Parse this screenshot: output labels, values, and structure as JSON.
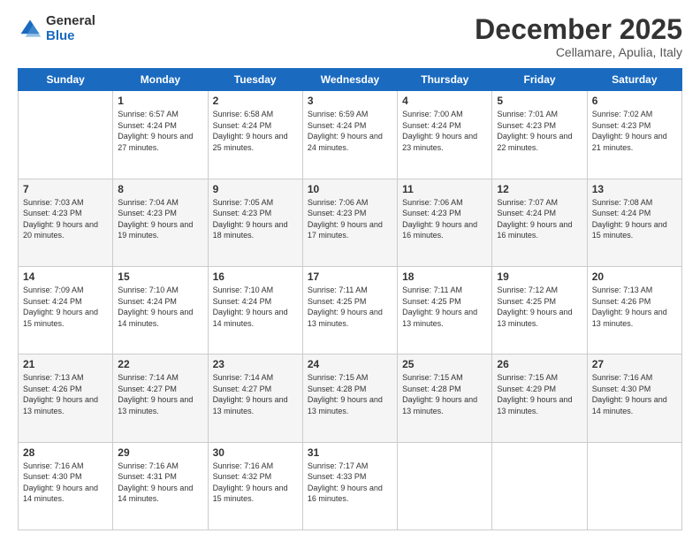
{
  "header": {
    "logo": {
      "general": "General",
      "blue": "Blue"
    },
    "title": "December 2025",
    "location": "Cellamare, Apulia, Italy"
  },
  "days_of_week": [
    "Sunday",
    "Monday",
    "Tuesday",
    "Wednesday",
    "Thursday",
    "Friday",
    "Saturday"
  ],
  "weeks": [
    [
      {
        "day": "",
        "sunrise": "",
        "sunset": "",
        "daylight": ""
      },
      {
        "day": "1",
        "sunrise": "Sunrise: 6:57 AM",
        "sunset": "Sunset: 4:24 PM",
        "daylight": "Daylight: 9 hours and 27 minutes."
      },
      {
        "day": "2",
        "sunrise": "Sunrise: 6:58 AM",
        "sunset": "Sunset: 4:24 PM",
        "daylight": "Daylight: 9 hours and 25 minutes."
      },
      {
        "day": "3",
        "sunrise": "Sunrise: 6:59 AM",
        "sunset": "Sunset: 4:24 PM",
        "daylight": "Daylight: 9 hours and 24 minutes."
      },
      {
        "day": "4",
        "sunrise": "Sunrise: 7:00 AM",
        "sunset": "Sunset: 4:24 PM",
        "daylight": "Daylight: 9 hours and 23 minutes."
      },
      {
        "day": "5",
        "sunrise": "Sunrise: 7:01 AM",
        "sunset": "Sunset: 4:23 PM",
        "daylight": "Daylight: 9 hours and 22 minutes."
      },
      {
        "day": "6",
        "sunrise": "Sunrise: 7:02 AM",
        "sunset": "Sunset: 4:23 PM",
        "daylight": "Daylight: 9 hours and 21 minutes."
      }
    ],
    [
      {
        "day": "7",
        "sunrise": "Sunrise: 7:03 AM",
        "sunset": "Sunset: 4:23 PM",
        "daylight": "Daylight: 9 hours and 20 minutes."
      },
      {
        "day": "8",
        "sunrise": "Sunrise: 7:04 AM",
        "sunset": "Sunset: 4:23 PM",
        "daylight": "Daylight: 9 hours and 19 minutes."
      },
      {
        "day": "9",
        "sunrise": "Sunrise: 7:05 AM",
        "sunset": "Sunset: 4:23 PM",
        "daylight": "Daylight: 9 hours and 18 minutes."
      },
      {
        "day": "10",
        "sunrise": "Sunrise: 7:06 AM",
        "sunset": "Sunset: 4:23 PM",
        "daylight": "Daylight: 9 hours and 17 minutes."
      },
      {
        "day": "11",
        "sunrise": "Sunrise: 7:06 AM",
        "sunset": "Sunset: 4:23 PM",
        "daylight": "Daylight: 9 hours and 16 minutes."
      },
      {
        "day": "12",
        "sunrise": "Sunrise: 7:07 AM",
        "sunset": "Sunset: 4:24 PM",
        "daylight": "Daylight: 9 hours and 16 minutes."
      },
      {
        "day": "13",
        "sunrise": "Sunrise: 7:08 AM",
        "sunset": "Sunset: 4:24 PM",
        "daylight": "Daylight: 9 hours and 15 minutes."
      }
    ],
    [
      {
        "day": "14",
        "sunrise": "Sunrise: 7:09 AM",
        "sunset": "Sunset: 4:24 PM",
        "daylight": "Daylight: 9 hours and 15 minutes."
      },
      {
        "day": "15",
        "sunrise": "Sunrise: 7:10 AM",
        "sunset": "Sunset: 4:24 PM",
        "daylight": "Daylight: 9 hours and 14 minutes."
      },
      {
        "day": "16",
        "sunrise": "Sunrise: 7:10 AM",
        "sunset": "Sunset: 4:24 PM",
        "daylight": "Daylight: 9 hours and 14 minutes."
      },
      {
        "day": "17",
        "sunrise": "Sunrise: 7:11 AM",
        "sunset": "Sunset: 4:25 PM",
        "daylight": "Daylight: 9 hours and 13 minutes."
      },
      {
        "day": "18",
        "sunrise": "Sunrise: 7:11 AM",
        "sunset": "Sunset: 4:25 PM",
        "daylight": "Daylight: 9 hours and 13 minutes."
      },
      {
        "day": "19",
        "sunrise": "Sunrise: 7:12 AM",
        "sunset": "Sunset: 4:25 PM",
        "daylight": "Daylight: 9 hours and 13 minutes."
      },
      {
        "day": "20",
        "sunrise": "Sunrise: 7:13 AM",
        "sunset": "Sunset: 4:26 PM",
        "daylight": "Daylight: 9 hours and 13 minutes."
      }
    ],
    [
      {
        "day": "21",
        "sunrise": "Sunrise: 7:13 AM",
        "sunset": "Sunset: 4:26 PM",
        "daylight": "Daylight: 9 hours and 13 minutes."
      },
      {
        "day": "22",
        "sunrise": "Sunrise: 7:14 AM",
        "sunset": "Sunset: 4:27 PM",
        "daylight": "Daylight: 9 hours and 13 minutes."
      },
      {
        "day": "23",
        "sunrise": "Sunrise: 7:14 AM",
        "sunset": "Sunset: 4:27 PM",
        "daylight": "Daylight: 9 hours and 13 minutes."
      },
      {
        "day": "24",
        "sunrise": "Sunrise: 7:15 AM",
        "sunset": "Sunset: 4:28 PM",
        "daylight": "Daylight: 9 hours and 13 minutes."
      },
      {
        "day": "25",
        "sunrise": "Sunrise: 7:15 AM",
        "sunset": "Sunset: 4:28 PM",
        "daylight": "Daylight: 9 hours and 13 minutes."
      },
      {
        "day": "26",
        "sunrise": "Sunrise: 7:15 AM",
        "sunset": "Sunset: 4:29 PM",
        "daylight": "Daylight: 9 hours and 13 minutes."
      },
      {
        "day": "27",
        "sunrise": "Sunrise: 7:16 AM",
        "sunset": "Sunset: 4:30 PM",
        "daylight": "Daylight: 9 hours and 14 minutes."
      }
    ],
    [
      {
        "day": "28",
        "sunrise": "Sunrise: 7:16 AM",
        "sunset": "Sunset: 4:30 PM",
        "daylight": "Daylight: 9 hours and 14 minutes."
      },
      {
        "day": "29",
        "sunrise": "Sunrise: 7:16 AM",
        "sunset": "Sunset: 4:31 PM",
        "daylight": "Daylight: 9 hours and 14 minutes."
      },
      {
        "day": "30",
        "sunrise": "Sunrise: 7:16 AM",
        "sunset": "Sunset: 4:32 PM",
        "daylight": "Daylight: 9 hours and 15 minutes."
      },
      {
        "day": "31",
        "sunrise": "Sunrise: 7:17 AM",
        "sunset": "Sunset: 4:33 PM",
        "daylight": "Daylight: 9 hours and 16 minutes."
      },
      {
        "day": "",
        "sunrise": "",
        "sunset": "",
        "daylight": ""
      },
      {
        "day": "",
        "sunrise": "",
        "sunset": "",
        "daylight": ""
      },
      {
        "day": "",
        "sunrise": "",
        "sunset": "",
        "daylight": ""
      }
    ]
  ]
}
